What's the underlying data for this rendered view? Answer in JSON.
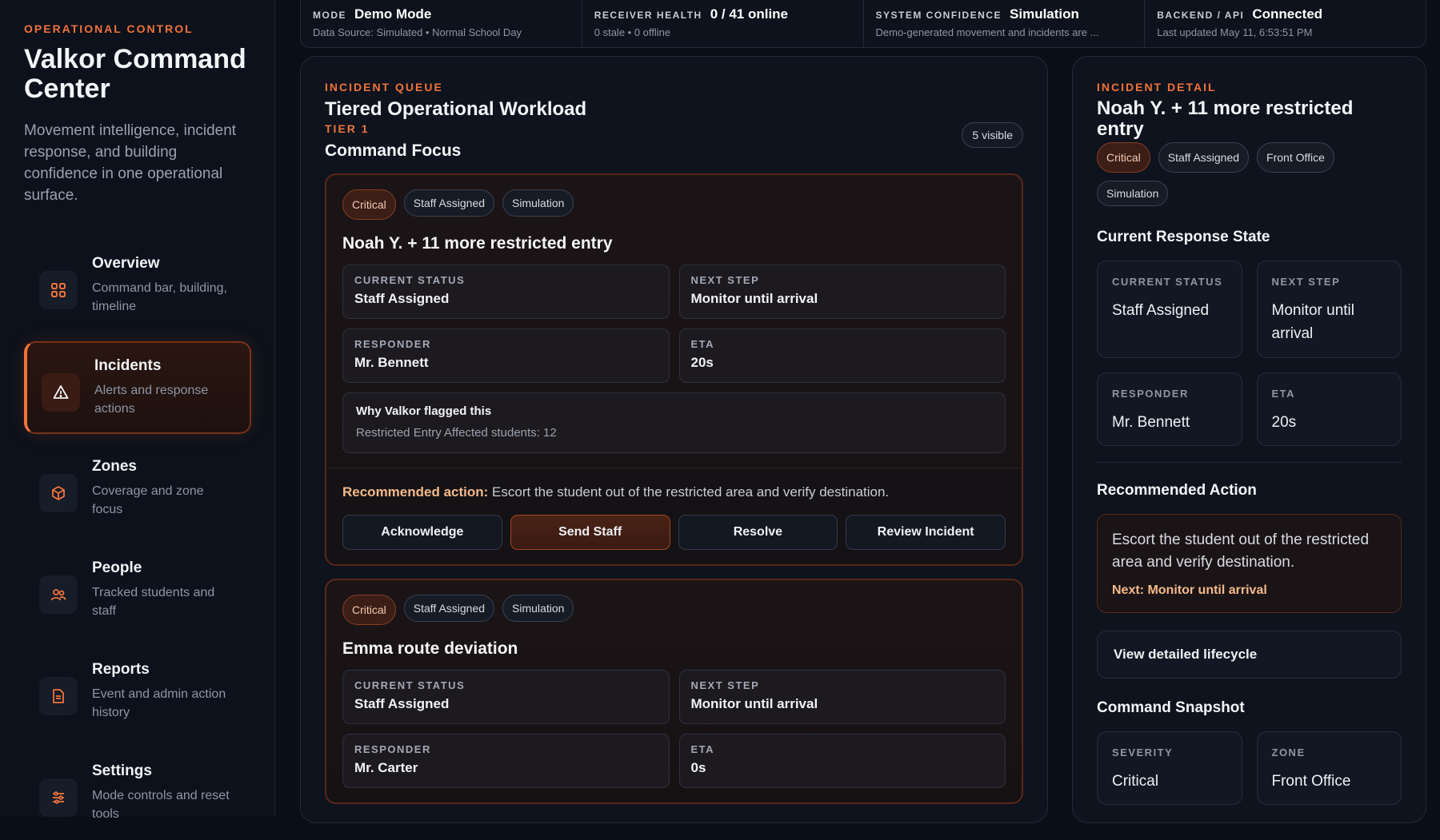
{
  "sidebar": {
    "eyebrow": "OPERATIONAL CONTROL",
    "title": "Valkor Command Center",
    "description": "Movement intelligence, incident response, and building confidence in one operational surface.",
    "items": [
      {
        "label": "Overview",
        "sub": "Command bar, building, timeline",
        "icon": "grid-icon",
        "active": false
      },
      {
        "label": "Incidents",
        "sub": "Alerts and response actions",
        "icon": "warning-icon",
        "active": true
      },
      {
        "label": "Zones",
        "sub": "Coverage and zone focus",
        "icon": "cube-icon",
        "active": false
      },
      {
        "label": "People",
        "sub": "Tracked students and staff",
        "icon": "people-icon",
        "active": false
      },
      {
        "label": "Reports",
        "sub": "Event and admin action history",
        "icon": "document-icon",
        "active": false
      },
      {
        "label": "Settings",
        "sub": "Mode controls and reset tools",
        "icon": "sliders-icon",
        "active": false
      }
    ]
  },
  "topbar": {
    "mode": {
      "label": "MODE",
      "value": "Demo Mode",
      "sub": "Data Source: Simulated • Normal School Day"
    },
    "receiver": {
      "label": "RECEIVER HEALTH",
      "value": "0 / 41 online",
      "sub": "0 stale • 0 offline"
    },
    "confidence": {
      "label": "SYSTEM CONFIDENCE",
      "value": "Simulation",
      "sub": "Demo-generated movement and incidents are ..."
    },
    "backend": {
      "label": "BACKEND / API",
      "value": "Connected",
      "sub": "Last updated May 11, 6:53:51 PM"
    }
  },
  "queue": {
    "eyebrow": "INCIDENT QUEUE",
    "title": "Tiered Operational Workload",
    "tier": "TIER 1",
    "subtitle": "Command Focus",
    "visible_badge": "5 visible",
    "incidents": [
      {
        "chips": [
          "Critical",
          "Staff Assigned",
          "Simulation"
        ],
        "title": "Noah Y. + 11 more restricted entry",
        "status_label": "CURRENT STATUS",
        "status": "Staff Assigned",
        "next_label": "NEXT STEP",
        "next": "Monitor until arrival",
        "responder_label": "RESPONDER",
        "responder": "Mr. Bennett",
        "eta_label": "ETA",
        "eta": "20s",
        "why_title": "Why Valkor flagged this",
        "why_text": "Restricted Entry Affected students: 12",
        "rec_label": "Recommended action:",
        "rec_text": "Escort the student out of the restricted area and verify destination.",
        "actions": [
          "Acknowledge",
          "Send Staff",
          "Resolve",
          "Review Incident"
        ]
      },
      {
        "chips": [
          "Critical",
          "Staff Assigned",
          "Simulation"
        ],
        "title": "Emma route deviation",
        "status_label": "CURRENT STATUS",
        "status": "Staff Assigned",
        "next_label": "NEXT STEP",
        "next": "Monitor until arrival",
        "responder_label": "RESPONDER",
        "responder": "Mr. Carter",
        "eta_label": "ETA",
        "eta": "0s"
      }
    ]
  },
  "detail": {
    "eyebrow": "INCIDENT DETAIL",
    "title": "Noah Y. + 11 more restricted entry",
    "chips": [
      "Critical",
      "Staff Assigned",
      "Front Office",
      "Simulation"
    ],
    "state_heading": "Current Response State",
    "status_label": "CURRENT STATUS",
    "status": "Staff Assigned",
    "next_label": "NEXT STEP",
    "next": "Monitor until arrival",
    "responder_label": "RESPONDER",
    "responder": "Mr. Bennett",
    "eta_label": "ETA",
    "eta": "20s",
    "rec_heading": "Recommended Action",
    "rec_text": "Escort the student out of the restricted area and verify destination.",
    "rec_next": "Next: Monitor until arrival",
    "lifecycle_button": "View detailed lifecycle",
    "snapshot_heading": "Command Snapshot",
    "severity_label": "SEVERITY",
    "severity": "Critical",
    "zone_label": "ZONE",
    "zone": "Front Office"
  },
  "colors": {
    "accent": "#f0733a",
    "background": "#0a0e17",
    "critical": "#8a3d22"
  }
}
